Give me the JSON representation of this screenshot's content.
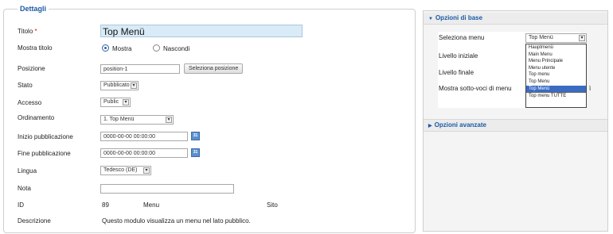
{
  "fieldset": {
    "legend": "Dettagli"
  },
  "form": {
    "title": {
      "label": "Titolo",
      "required_mark": "*",
      "value": "Top Menü"
    },
    "show_title": {
      "label": "Mostra titolo",
      "options": [
        "Mostra",
        "Nascondi"
      ],
      "selected": "Mostra"
    },
    "position": {
      "label": "Posizione",
      "value": "position-1",
      "button": "Seleziona posizione"
    },
    "state": {
      "label": "Stato",
      "value": "Pubblicato"
    },
    "access": {
      "label": "Accesso",
      "value": "Public"
    },
    "ordering": {
      "label": "Ordinamento",
      "value": "1. Top Menü"
    },
    "publish_up": {
      "label": "Inizio pubblicazione",
      "value": "0000-00-00 00:00:00"
    },
    "publish_down": {
      "label": "Fine pubblicazione",
      "value": "0000-00-00 00:00:00"
    },
    "language": {
      "label": "Lingua",
      "value": "Tedesco (DE)"
    },
    "note": {
      "label": "Nota",
      "value": ""
    },
    "id": {
      "label": "ID",
      "value": "89",
      "type": "Menu",
      "site": "Sito"
    },
    "description": {
      "label": "Descrizione",
      "value": "Questo modulo visualizza un menu nel lato pubblico."
    }
  },
  "right_panel": {
    "basic_options_title": "Opzioni di base",
    "advanced_options_title": "Opzioni avanzate",
    "select_menu": {
      "label": "Seleziona menu",
      "value": "Top Menü"
    },
    "start_level_label": "Livello iniziale",
    "end_level_label": "Livello finale",
    "show_subitems_label": "Mostra sotto-voci di menu",
    "show_subitems_partial": "ì",
    "dropdown_options": [
      "Hauptmenü",
      "Main Menu",
      "Menu Principale",
      "Menu utente",
      "Top menu",
      "Top Menu",
      "Top Menü",
      "Top menu TUTTE"
    ],
    "dropdown_selected_index": 6
  },
  "colors": {
    "legend": "#1b5aa5",
    "title_input_bg": "#d9ebf7",
    "highlight": "#3b6cc2",
    "required": "#d01818"
  },
  "icons": {
    "calendar": "calendar-icon",
    "collapse": "triangle-down-icon",
    "expand": "triangle-right-icon"
  },
  "calendar_glyph": "31"
}
